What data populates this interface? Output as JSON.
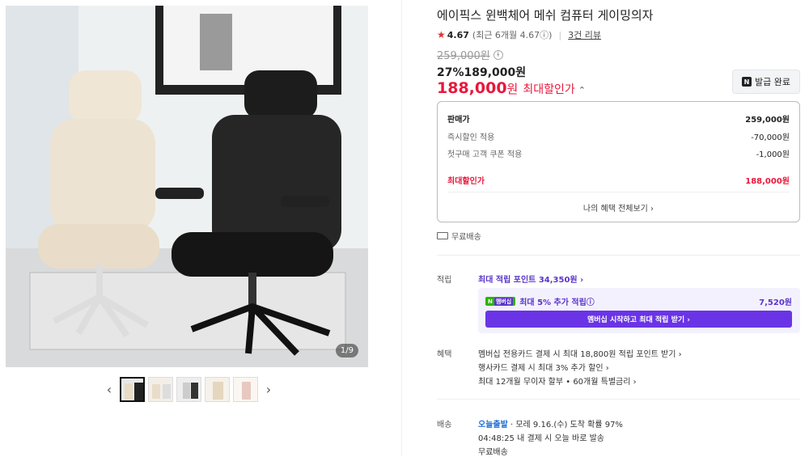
{
  "product": {
    "title": "에이픽스 윈백체어 메쉬 컴퓨터 게이밍의자",
    "rating": "4.67",
    "rating_sub": "(최근 6개월 4.67ⓘ)",
    "review_link": "3건 리뷰",
    "original_price": "259,000원",
    "discount_line": "27%189,000원",
    "final_price": "188,000",
    "final_price_unit": "원",
    "final_label": "최대할인가"
  },
  "gallery": {
    "counter": "1/9",
    "prev_icon": "‹",
    "next_icon": "›",
    "thumbnails": [
      "thumb-1",
      "thumb-2",
      "thumb-3",
      "thumb-4",
      "thumb-5"
    ]
  },
  "coupon_button": {
    "label": "발급 완료",
    "badge": "N"
  },
  "price_box": {
    "rows": [
      {
        "label": "판매가",
        "value": "259,000원"
      },
      {
        "label": "즉시할인 적용",
        "value": "-70,000원"
      },
      {
        "label": "첫구매 고객 쿠폰 적용",
        "value": "-1,000원"
      },
      {
        "label": "최대할인가",
        "value": "188,000원"
      }
    ],
    "benefits_link": "나의 혜택 전체보기 ›"
  },
  "shipping_free": "무료배송",
  "points": {
    "label": "적립",
    "max_points": "최대 적립 포인트 34,350원 ›",
    "membership_badge": "N",
    "membership_badge_sub": "멤버십",
    "membership_text": "최대 5% 추가 적립ⓘ",
    "membership_value": "7,520원",
    "membership_button": "멤버십 시작하고 최대 적립 받기 ›"
  },
  "benefits": {
    "label": "혜택",
    "items": [
      "멤버십 전용카드 결제 시 최대 18,800원 적립 포인트 받기 ›",
      "행사카드 결제 시 최대 3% 추가 할인 ›",
      "최대 12개월 무이자 할부 • 60개월 특별금리 ›"
    ]
  },
  "delivery": {
    "label": "배송",
    "badge": "오늘출발",
    "arrival": " · 모레 9.16.(수) 도착 확률 97%",
    "countdown": "04:48:25  내 결제 시 오늘 바로 발송",
    "fee": "무료배송"
  }
}
